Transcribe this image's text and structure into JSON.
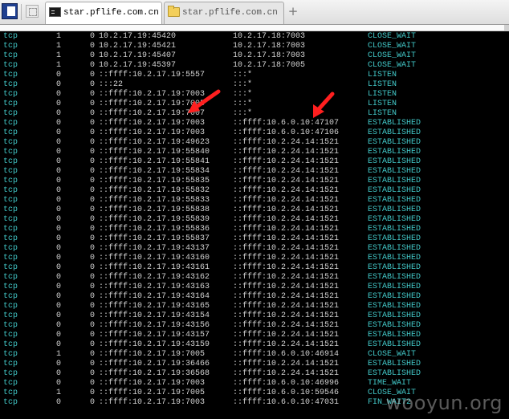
{
  "tabs": [
    {
      "label": "star.pflife.com.cn",
      "icon": "terminal-icon",
      "active": true
    },
    {
      "label": "star.pflife.com.cn",
      "icon": "folder-icon",
      "active": false
    }
  ],
  "new_tab_label": "+",
  "colors": {
    "terminal_background": "#000000",
    "text": "#d2d2d2",
    "cyan": "#42c8c8",
    "annotation_arrow": "#ff1f1f"
  },
  "netstat_rows": [
    {
      "proto": "tcp",
      "recvq": "1",
      "sendq": "0",
      "local": "10.2.17.19:45420",
      "foreign": "10.2.17.18:7003",
      "state": "CLOSE_WAIT"
    },
    {
      "proto": "tcp",
      "recvq": "1",
      "sendq": "0",
      "local": "10.2.17.19:45421",
      "foreign": "10.2.17.18:7003",
      "state": "CLOSE_WAIT"
    },
    {
      "proto": "tcp",
      "recvq": "1",
      "sendq": "0",
      "local": "10.2.17.19:45407",
      "foreign": "10.2.17.18:7003",
      "state": "CLOSE_WAIT"
    },
    {
      "proto": "tcp",
      "recvq": "1",
      "sendq": "0",
      "local": "10.2.17.19:45397",
      "foreign": "10.2.17.18:7005",
      "state": "CLOSE_WAIT"
    },
    {
      "proto": "tcp",
      "recvq": "0",
      "sendq": "0",
      "local": "::ffff:10.2.17.19:5557",
      "foreign": ":::*",
      "state": "LISTEN"
    },
    {
      "proto": "tcp",
      "recvq": "0",
      "sendq": "0",
      "local": ":::22",
      "foreign": ":::*",
      "state": "LISTEN"
    },
    {
      "proto": "tcp",
      "recvq": "0",
      "sendq": "0",
      "local": "::ffff:10.2.17.19:7003",
      "foreign": ":::*",
      "state": "LISTEN"
    },
    {
      "proto": "tcp",
      "recvq": "0",
      "sendq": "0",
      "local": "::ffff:10.2.17.19:7005",
      "foreign": ":::*",
      "state": "LISTEN"
    },
    {
      "proto": "tcp",
      "recvq": "0",
      "sendq": "0",
      "local": "::ffff:10.2.17.19:7007",
      "foreign": ":::*",
      "state": "LISTEN"
    },
    {
      "proto": "tcp",
      "recvq": "0",
      "sendq": "0",
      "local": "::ffff:10.2.17.19:7003",
      "foreign": "::ffff:10.6.0.10:47107",
      "state": "ESTABLISHED"
    },
    {
      "proto": "tcp",
      "recvq": "0",
      "sendq": "0",
      "local": "::ffff:10.2.17.19:7003",
      "foreign": "::ffff:10.6.0.10:47106",
      "state": "ESTABLISHED"
    },
    {
      "proto": "tcp",
      "recvq": "0",
      "sendq": "0",
      "local": "::ffff:10.2.17.19:49623",
      "foreign": "::ffff:10.2.24.14:1521",
      "state": "ESTABLISHED"
    },
    {
      "proto": "tcp",
      "recvq": "0",
      "sendq": "0",
      "local": "::ffff:10.2.17.19:55840",
      "foreign": "::ffff:10.2.24.14:1521",
      "state": "ESTABLISHED"
    },
    {
      "proto": "tcp",
      "recvq": "0",
      "sendq": "0",
      "local": "::ffff:10.2.17.19:55841",
      "foreign": "::ffff:10.2.24.14:1521",
      "state": "ESTABLISHED"
    },
    {
      "proto": "tcp",
      "recvq": "0",
      "sendq": "0",
      "local": "::ffff:10.2.17.19:55834",
      "foreign": "::ffff:10.2.24.14:1521",
      "state": "ESTABLISHED"
    },
    {
      "proto": "tcp",
      "recvq": "0",
      "sendq": "0",
      "local": "::ffff:10.2.17.19:55835",
      "foreign": "::ffff:10.2.24.14:1521",
      "state": "ESTABLISHED"
    },
    {
      "proto": "tcp",
      "recvq": "0",
      "sendq": "0",
      "local": "::ffff:10.2.17.19:55832",
      "foreign": "::ffff:10.2.24.14:1521",
      "state": "ESTABLISHED"
    },
    {
      "proto": "tcp",
      "recvq": "0",
      "sendq": "0",
      "local": "::ffff:10.2.17.19:55833",
      "foreign": "::ffff:10.2.24.14:1521",
      "state": "ESTABLISHED"
    },
    {
      "proto": "tcp",
      "recvq": "0",
      "sendq": "0",
      "local": "::ffff:10.2.17.19:55838",
      "foreign": "::ffff:10.2.24.14:1521",
      "state": "ESTABLISHED"
    },
    {
      "proto": "tcp",
      "recvq": "0",
      "sendq": "0",
      "local": "::ffff:10.2.17.19:55839",
      "foreign": "::ffff:10.2.24.14:1521",
      "state": "ESTABLISHED"
    },
    {
      "proto": "tcp",
      "recvq": "0",
      "sendq": "0",
      "local": "::ffff:10.2.17.19:55836",
      "foreign": "::ffff:10.2.24.14:1521",
      "state": "ESTABLISHED"
    },
    {
      "proto": "tcp",
      "recvq": "0",
      "sendq": "0",
      "local": "::ffff:10.2.17.19:55837",
      "foreign": "::ffff:10.2.24.14:1521",
      "state": "ESTABLISHED"
    },
    {
      "proto": "tcp",
      "recvq": "0",
      "sendq": "0",
      "local": "::ffff:10.2.17.19:43137",
      "foreign": "::ffff:10.2.24.14:1521",
      "state": "ESTABLISHED"
    },
    {
      "proto": "tcp",
      "recvq": "0",
      "sendq": "0",
      "local": "::ffff:10.2.17.19:43160",
      "foreign": "::ffff:10.2.24.14:1521",
      "state": "ESTABLISHED"
    },
    {
      "proto": "tcp",
      "recvq": "0",
      "sendq": "0",
      "local": "::ffff:10.2.17.19:43161",
      "foreign": "::ffff:10.2.24.14:1521",
      "state": "ESTABLISHED"
    },
    {
      "proto": "tcp",
      "recvq": "0",
      "sendq": "0",
      "local": "::ffff:10.2.17.19:43162",
      "foreign": "::ffff:10.2.24.14:1521",
      "state": "ESTABLISHED"
    },
    {
      "proto": "tcp",
      "recvq": "0",
      "sendq": "0",
      "local": "::ffff:10.2.17.19:43163",
      "foreign": "::ffff:10.2.24.14:1521",
      "state": "ESTABLISHED"
    },
    {
      "proto": "tcp",
      "recvq": "0",
      "sendq": "0",
      "local": "::ffff:10.2.17.19:43164",
      "foreign": "::ffff:10.2.24.14:1521",
      "state": "ESTABLISHED"
    },
    {
      "proto": "tcp",
      "recvq": "0",
      "sendq": "0",
      "local": "::ffff:10.2.17.19:43165",
      "foreign": "::ffff:10.2.24.14:1521",
      "state": "ESTABLISHED"
    },
    {
      "proto": "tcp",
      "recvq": "0",
      "sendq": "0",
      "local": "::ffff:10.2.17.19:43154",
      "foreign": "::ffff:10.2.24.14:1521",
      "state": "ESTABLISHED"
    },
    {
      "proto": "tcp",
      "recvq": "0",
      "sendq": "0",
      "local": "::ffff:10.2.17.19:43156",
      "foreign": "::ffff:10.2.24.14:1521",
      "state": "ESTABLISHED"
    },
    {
      "proto": "tcp",
      "recvq": "0",
      "sendq": "0",
      "local": "::ffff:10.2.17.19:43157",
      "foreign": "::ffff:10.2.24.14:1521",
      "state": "ESTABLISHED"
    },
    {
      "proto": "tcp",
      "recvq": "0",
      "sendq": "0",
      "local": "::ffff:10.2.17.19:43159",
      "foreign": "::ffff:10.2.24.14:1521",
      "state": "ESTABLISHED"
    },
    {
      "proto": "tcp",
      "recvq": "1",
      "sendq": "0",
      "local": "::ffff:10.2.17.19:7005",
      "foreign": "::ffff:10.6.0.10:46914",
      "state": "CLOSE_WAIT"
    },
    {
      "proto": "tcp",
      "recvq": "0",
      "sendq": "0",
      "local": "::ffff:10.2.17.19:36466",
      "foreign": "::ffff:10.2.24.14:1521",
      "state": "ESTABLISHED"
    },
    {
      "proto": "tcp",
      "recvq": "0",
      "sendq": "0",
      "local": "::ffff:10.2.17.19:36568",
      "foreign": "::ffff:10.2.24.14:1521",
      "state": "ESTABLISHED"
    },
    {
      "proto": "tcp",
      "recvq": "0",
      "sendq": "0",
      "local": "::ffff:10.2.17.19:7003",
      "foreign": "::ffff:10.6.0.10:46996",
      "state": "TIME_WAIT"
    },
    {
      "proto": "tcp",
      "recvq": "1",
      "sendq": "0",
      "local": "::ffff:10.2.17.19:7005",
      "foreign": "::ffff:10.6.0.10:59546",
      "state": "CLOSE_WAIT"
    },
    {
      "proto": "tcp",
      "recvq": "0",
      "sendq": "0",
      "local": "::ffff:10.2.17.19:7003",
      "foreign": "::ffff:10.6.0.10:47031",
      "state": "FIN_WAIT2"
    }
  ],
  "watermark": "wooyun.org"
}
